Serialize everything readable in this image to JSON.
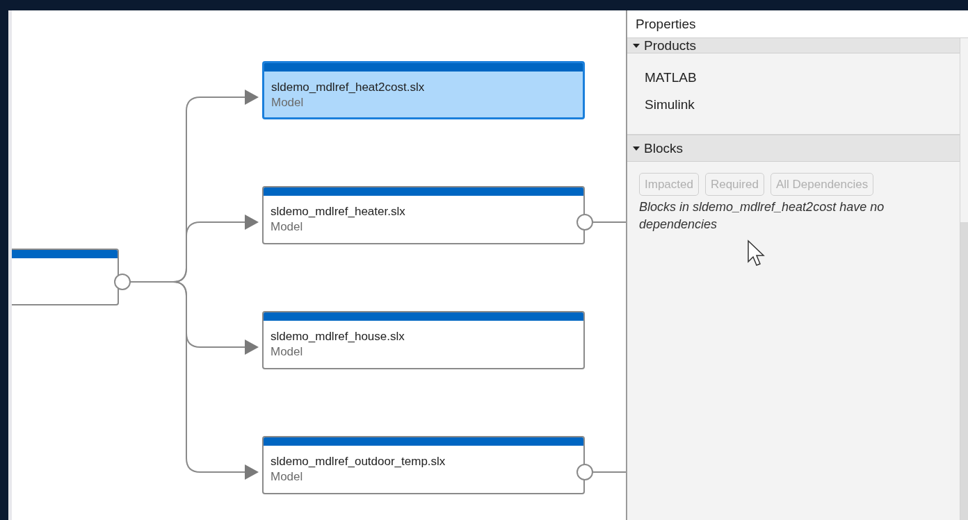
{
  "graph": {
    "nodes": [
      {
        "name": "sldemo_mdlref_heat2cost.slx",
        "type": "Model",
        "selected": true,
        "port": false
      },
      {
        "name": "sldemo_mdlref_heater.slx",
        "type": "Model",
        "selected": false,
        "port": true
      },
      {
        "name": "sldemo_mdlref_house.slx",
        "type": "Model",
        "selected": false,
        "port": false
      },
      {
        "name": "sldemo_mdlref_outdoor_temp.slx",
        "type": "Model",
        "selected": false,
        "port": true
      }
    ]
  },
  "properties": {
    "title": "Properties",
    "sections": [
      {
        "title": "Products",
        "expanded": true,
        "items": [
          "MATLAB",
          "Simulink"
        ]
      },
      {
        "title": "Blocks",
        "expanded": true,
        "buttons": [
          {
            "label": "Impacted",
            "disabled": true
          },
          {
            "label": "Required",
            "disabled": true
          },
          {
            "label": "All Dependencies",
            "disabled": true
          }
        ],
        "message": "Blocks in sldemo_mdlref_heat2cost have no dependencies"
      }
    ]
  }
}
